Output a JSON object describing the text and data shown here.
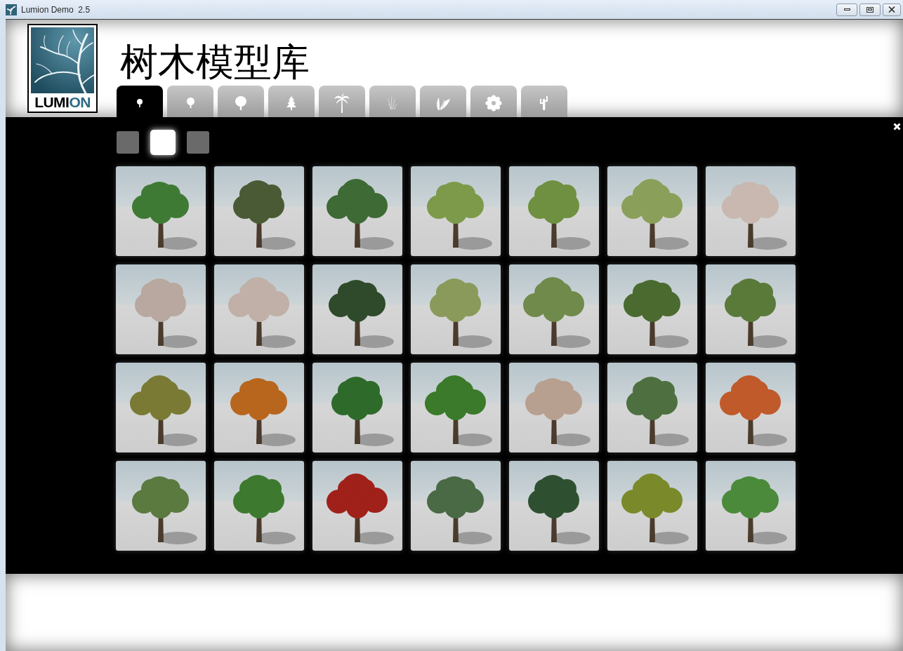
{
  "window": {
    "title": "Lumion Demo  2.5"
  },
  "logo": {
    "wordmark": "LUMI",
    "wordmark_accent": "ON"
  },
  "page_title": "树木模型库",
  "category_tabs": [
    {
      "selected": true
    },
    {
      "selected": false
    },
    {
      "selected": false
    },
    {
      "selected": false
    },
    {
      "selected": false
    },
    {
      "selected": false
    },
    {
      "selected": false
    },
    {
      "selected": false
    },
    {
      "selected": false
    }
  ],
  "pages": [
    {
      "selected": false
    },
    {
      "selected": true
    },
    {
      "selected": false
    }
  ],
  "models": [
    {
      "color": "#3f7a35"
    },
    {
      "color": "#4a5a35"
    },
    {
      "color": "#3e6a35"
    },
    {
      "color": "#7c9a4a"
    },
    {
      "color": "#6f9040"
    },
    {
      "color": "#8aa05a"
    },
    {
      "color": "#c8b8b0"
    },
    {
      "color": "#b8a8a0"
    },
    {
      "color": "#c0b0a8"
    },
    {
      "color": "#2e4a2a"
    },
    {
      "color": "#8a9a5a"
    },
    {
      "color": "#6f8a4a"
    },
    {
      "color": "#4a6a30"
    },
    {
      "color": "#5a7a3a"
    },
    {
      "color": "#7a7a35"
    },
    {
      "color": "#b8661e"
    },
    {
      "color": "#2e6a2a"
    },
    {
      "color": "#3a7a2a"
    },
    {
      "color": "#b8a090"
    },
    {
      "color": "#4e7040"
    },
    {
      "color": "#c05a2a"
    },
    {
      "color": "#5a7a40"
    },
    {
      "color": "#3d7a30"
    },
    {
      "color": "#a0201a"
    },
    {
      "color": "#4a6a45"
    },
    {
      "color": "#2e5030"
    },
    {
      "color": "#7a8a2a"
    },
    {
      "color": "#4a8a3a"
    }
  ]
}
